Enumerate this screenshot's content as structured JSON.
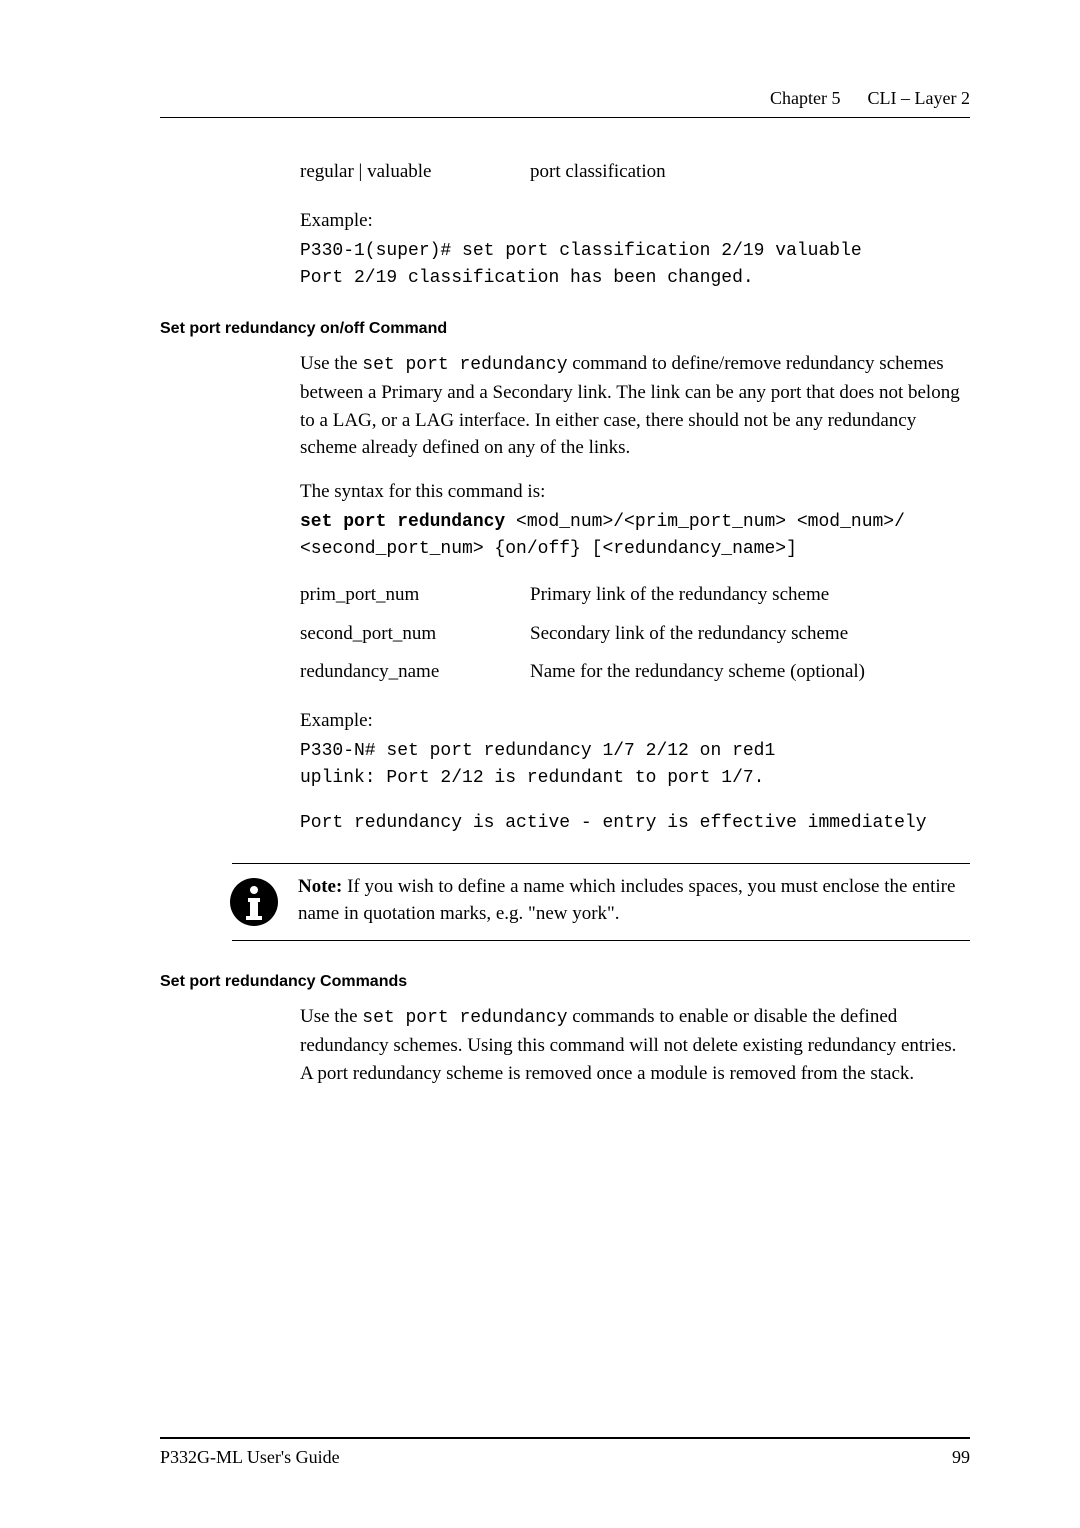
{
  "header": {
    "chapter": "Chapter 5",
    "title": "CLI – Layer 2"
  },
  "def1": {
    "col1": "regular | valuable",
    "col2": "port classification"
  },
  "example1": {
    "label": "Example:",
    "line1": "P330-1(super)# set port classification 2/19 valuable",
    "line2": "Port 2/19 classification has been changed."
  },
  "section2": {
    "heading": "Set port redundancy on/off Command",
    "intro_pre": "Use the ",
    "intro_code": "set port redundancy",
    "intro_post": " command to define/remove redundancy schemes between a Primary and a Secondary link. The link can be any port that does not belong to a LAG, or a LAG interface. In either case, there should not be any redundancy scheme already defined on any of the links.",
    "syntax_label": "The syntax for this command is:",
    "syntax_bold": "set port redundancy",
    "syntax_rest1": " <mod_num>/<prim_port_num> <mod_num>/",
    "syntax_rest2": "<second_port_num> {on/off} [<redundancy_name>]",
    "defs": [
      {
        "name": "prim_port_num",
        "desc": "Primary link of the redundancy scheme"
      },
      {
        "name": "second_port_num",
        "desc": "Secondary link of the redundancy scheme"
      },
      {
        "name": "redundancy_name",
        "desc": "Name for the redundancy scheme (optional)"
      }
    ],
    "example_label": "Example:",
    "example_line1": "P330-N# set port redundancy 1/7 2/12 on red1",
    "example_line2": "uplink: Port 2/12 is redundant to port 1/7.",
    "example_line3": "Port redundancy is active - entry is effective immediately"
  },
  "note": {
    "label": "Note:",
    "text": "  If you wish to define a name which includes spaces, you must enclose the entire name in quotation marks, e.g. \"new york\"."
  },
  "section3": {
    "heading": "Set port redundancy Commands",
    "intro_pre": "Use the ",
    "intro_code": "set port redundancy",
    "intro_post": " commands to enable or disable the defined redundancy schemes. Using this command will not delete existing redundancy entries. A port redundancy scheme is removed once a module is removed from the stack."
  },
  "footer": {
    "left": "P332G-ML User's Guide",
    "right": "99"
  }
}
